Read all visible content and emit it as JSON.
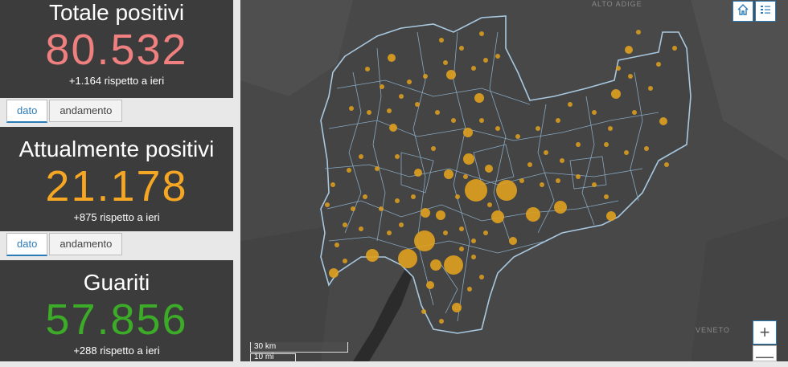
{
  "cards": [
    {
      "title": "Totale positivi",
      "value": "80.532",
      "delta": "+1.164 rispetto a ieri",
      "color": "#f08080"
    },
    {
      "title": "Attualmente positivi",
      "value": "21.178",
      "delta": "+875 rispetto a ieri",
      "color": "#f5a623"
    },
    {
      "title": "Guariti",
      "value": "57.856",
      "delta": "+288 rispetto a ieri",
      "color": "#3cab28"
    }
  ],
  "tabs": {
    "dato": "dato",
    "andamento": "andamento"
  },
  "map": {
    "labels": {
      "alto_adige": "ALTO ADIGE",
      "veneto": "VENETO"
    },
    "scale": {
      "km": "30 km",
      "mi": "10 mi"
    },
    "zoom": {
      "in": "+",
      "out": "—"
    },
    "bubble_color": "#e0a11f",
    "boundary_color": "#a8c8e0",
    "icons": [
      "home-icon",
      "legend-icon"
    ]
  }
}
